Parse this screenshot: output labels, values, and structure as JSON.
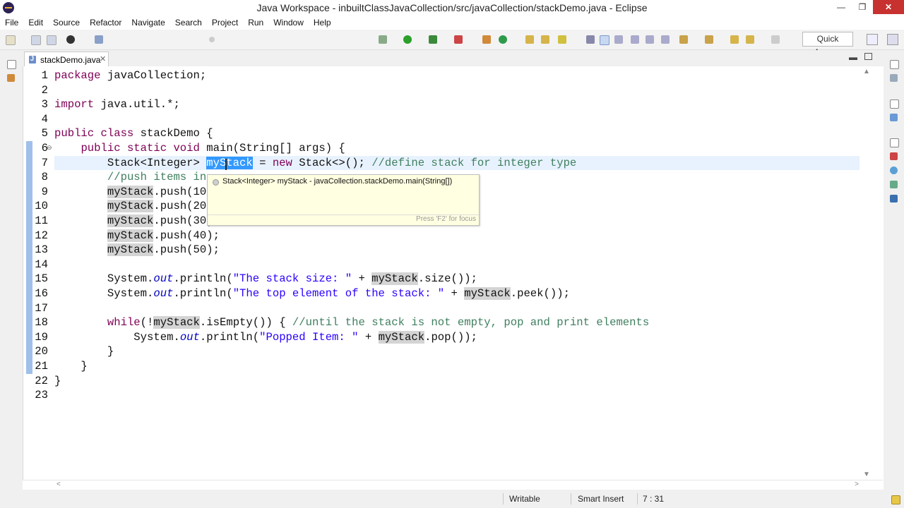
{
  "window": {
    "title": "Java Workspace - inbuiltClassJavaCollection/src/javaCollection/stackDemo.java - Eclipse",
    "minimize": "—",
    "restore": "❐",
    "close": "✕"
  },
  "menu": [
    "File",
    "Edit",
    "Source",
    "Refactor",
    "Navigate",
    "Search",
    "Project",
    "Run",
    "Window",
    "Help"
  ],
  "toolbar": {
    "quick_access": "Quick Access"
  },
  "editor_tab": {
    "label": "stackDemo.java",
    "close": "✕"
  },
  "code": [
    {
      "n": "1",
      "t": "package javaCollection;"
    },
    {
      "n": "2",
      "t": ""
    },
    {
      "n": "3",
      "t": "import java.util.*;"
    },
    {
      "n": "4",
      "t": ""
    },
    {
      "n": "5",
      "t": "public class stackDemo {"
    },
    {
      "n": "6",
      "t": "    public static void main(String[] args) {"
    },
    {
      "n": "7",
      "t": "        Stack<Integer> myStack = new Stack<>(); //define stack for integer type"
    },
    {
      "n": "8",
      "t": "        //push items in"
    },
    {
      "n": "9",
      "t": "        myStack.push(10"
    },
    {
      "n": "10",
      "t": "        myStack.push(20"
    },
    {
      "n": "11",
      "t": "        myStack.push(30);"
    },
    {
      "n": "12",
      "t": "        myStack.push(40);"
    },
    {
      "n": "13",
      "t": "        myStack.push(50);"
    },
    {
      "n": "14",
      "t": ""
    },
    {
      "n": "15",
      "t": "        System.out.println(\"The stack size: \" + myStack.size());"
    },
    {
      "n": "16",
      "t": "        System.out.println(\"The top element of the stack: \" + myStack.peek());"
    },
    {
      "n": "17",
      "t": ""
    },
    {
      "n": "18",
      "t": "        while(!myStack.isEmpty()) { //until the stack is not empty, pop and print elements"
    },
    {
      "n": "19",
      "t": "            System.out.println(\"Popped Item: \" + myStack.pop());"
    },
    {
      "n": "20",
      "t": "        }"
    },
    {
      "n": "21",
      "t": "    }"
    },
    {
      "n": "22",
      "t": "}"
    },
    {
      "n": "23",
      "t": ""
    }
  ],
  "tooltip": {
    "text": "Stack<Integer> myStack - javaCollection.stackDemo.main(String[])",
    "focus_hint": "Press 'F2' for focus"
  },
  "status": {
    "writable": "Writable",
    "insert_mode": "Smart Insert",
    "position": "7 : 31"
  },
  "colors": {
    "keyword": "#7f0055",
    "string": "#2a00ff",
    "comment": "#3f7f5f",
    "selection": "#3399ff",
    "occurrence": "#d4d4d4",
    "tooltip_bg": "#ffffe1"
  }
}
